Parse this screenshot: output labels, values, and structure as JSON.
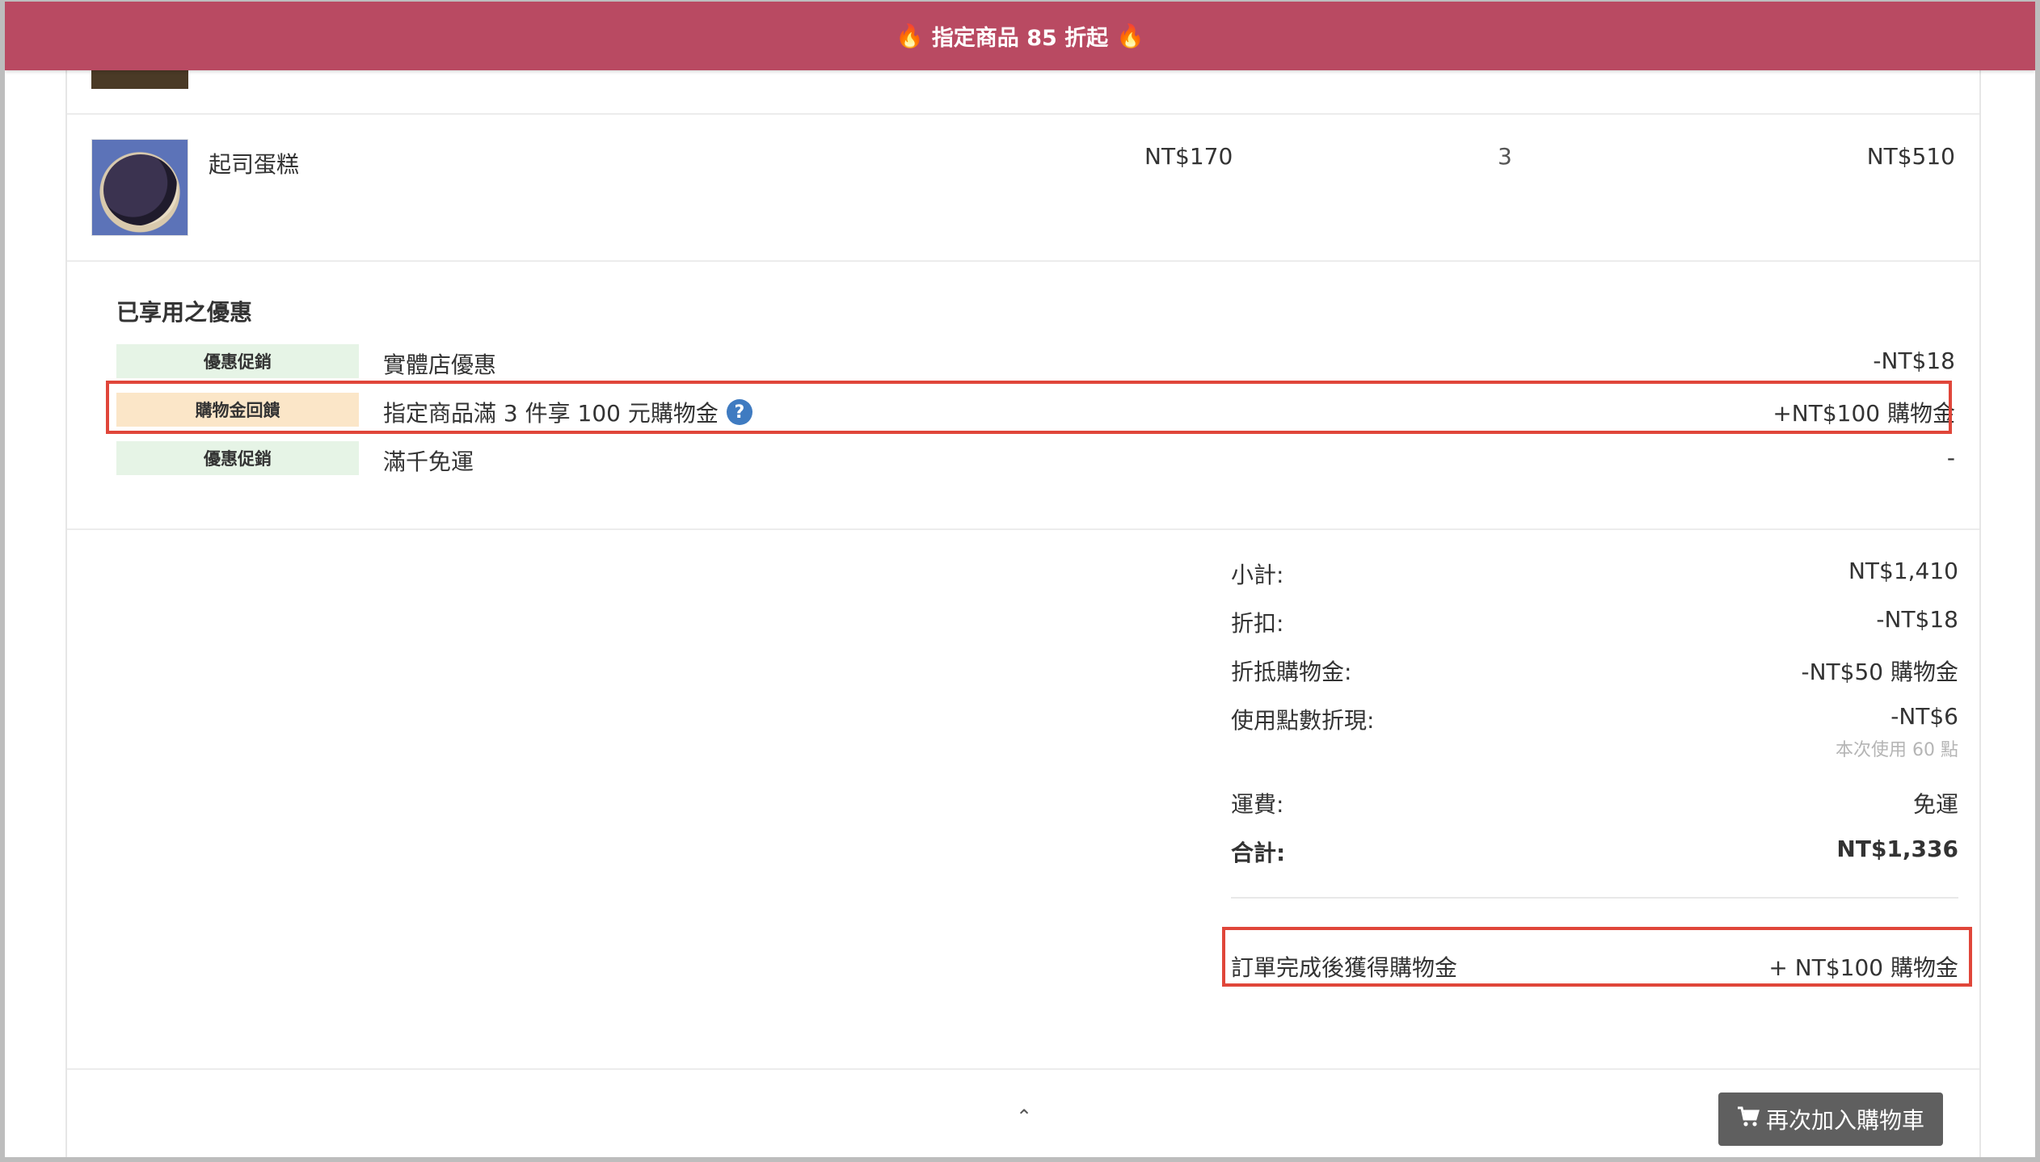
{
  "announcement": {
    "text": "指定商品 85 折起",
    "icon_left": "🔥",
    "icon_right": "🔥"
  },
  "product": {
    "name": "起司蛋糕",
    "price": "NT$170",
    "quantity": "3",
    "total": "NT$510",
    "image_icon": "cheesecake-image"
  },
  "promotions": {
    "title": "已享用之優惠",
    "items": [
      {
        "tag": "優惠促銷",
        "name": "實體店優惠",
        "amount": "-NT$18",
        "tag_color": "#e6f4e6"
      },
      {
        "tag": "購物金回饋",
        "name": "指定商品滿 3 件享 100 元購物金",
        "amount": "+NT$100 購物金",
        "tag_color": "#fbe6c8",
        "has_help": true
      },
      {
        "tag": "優惠促銷",
        "name": "滿千免運",
        "amount": "-",
        "tag_color": "#e6f4e6"
      }
    ],
    "help_icon": "?"
  },
  "summary": {
    "subtotal_label": "小計:",
    "subtotal_value": "NT$1,410",
    "discount_label": "折扣:",
    "discount_value": "-NT$18",
    "credit_label": "折抵購物金:",
    "credit_value": "-NT$50 購物金",
    "points_label": "使用點數折現:",
    "points_value": "-NT$6",
    "points_note": "本次使用 60 點",
    "shipping_label": "運費:",
    "shipping_value": "免運",
    "total_label": "合計:",
    "total_value": "NT$1,336",
    "reward_label": "訂單完成後獲得購物金",
    "reward_value": "+ NT$100 購物金"
  },
  "footer": {
    "readd_button": "再次加入購物車",
    "cart_icon": "shopping-cart-icon",
    "chevron": "⌃"
  },
  "colors": {
    "announcement_bg": "#b94a62",
    "highlight_border": "#e0463a",
    "button_bg": "#5f5f5f"
  }
}
